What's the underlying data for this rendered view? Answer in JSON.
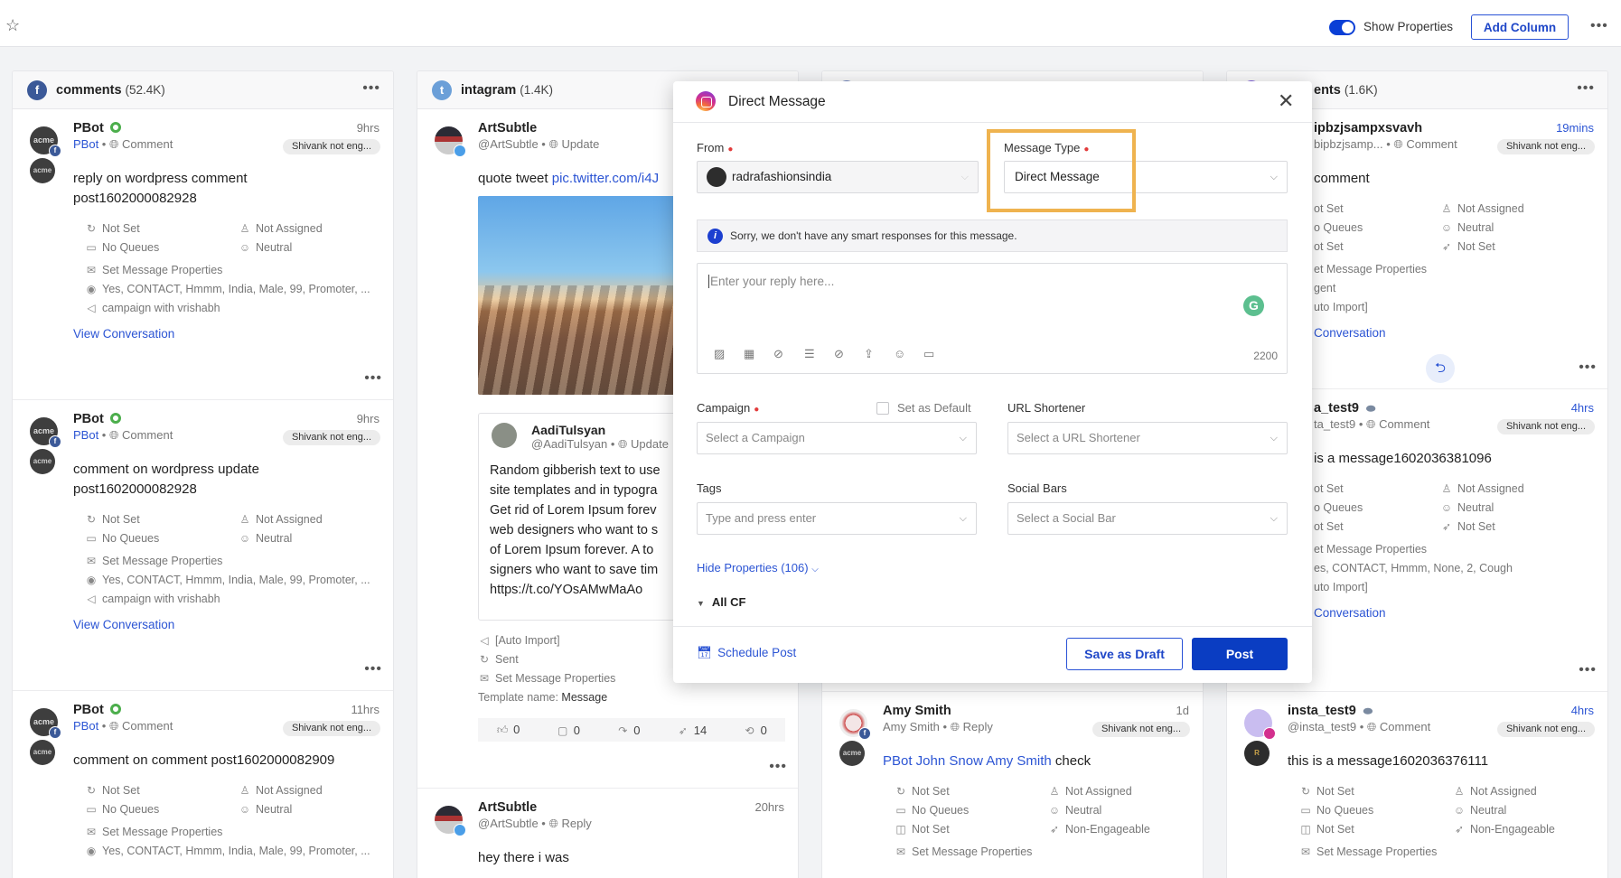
{
  "topbar": {
    "star_icon": "star-icon",
    "show_properties_label": "Show Properties",
    "show_properties_on": true,
    "add_column_label": "Add Column"
  },
  "colors": {
    "accent": "#0a3dc2",
    "link": "#2c55d4",
    "highlight": "#efb34f",
    "online": "#4cae4c",
    "grammarly": "#5cbf8f"
  },
  "columns": [
    {
      "title": "comments",
      "count": "(52.4K)",
      "icon": "facebook-icon",
      "icon_color": "#3b5998",
      "icon_glyph": "f",
      "cards": [
        {
          "avatar": "acme",
          "badge": "facebook",
          "name": "PBot",
          "status": "online",
          "handle": "PBot",
          "handle_link": true,
          "type": "Comment",
          "time": "9hrs",
          "tag": "Shivank not eng...",
          "author": "acme",
          "text": [
            "reply on wordpress comment",
            "post1602000082928"
          ],
          "props": [
            [
              "Not Set",
              "Not Assigned"
            ],
            [
              "No Queues",
              "Neutral"
            ]
          ],
          "lines": [
            {
              "icon": "message-properties-icon",
              "text": "Set Message Properties"
            },
            {
              "icon": "contact-icon",
              "text": "Yes, CONTACT, Hmmm, India, Male, 99, Promoter, ..."
            },
            {
              "icon": "campaign-icon",
              "text": "campaign with vrishabh"
            }
          ],
          "link": "View Conversation",
          "more": true
        },
        {
          "avatar": "acme",
          "badge": "facebook",
          "name": "PBot",
          "status": "online",
          "handle": "PBot",
          "handle_link": true,
          "type": "Comment",
          "time": "9hrs",
          "tag": "Shivank not eng...",
          "author": "acme",
          "text": [
            "comment on wordpress update",
            "post1602000082928"
          ],
          "props": [
            [
              "Not Set",
              "Not Assigned"
            ],
            [
              "No Queues",
              "Neutral"
            ]
          ],
          "lines": [
            {
              "icon": "message-properties-icon",
              "text": "Set Message Properties"
            },
            {
              "icon": "contact-icon",
              "text": "Yes, CONTACT, Hmmm, India, Male, 99, Promoter, ..."
            },
            {
              "icon": "campaign-icon",
              "text": "campaign with vrishabh"
            }
          ],
          "link": "View Conversation",
          "more": true
        },
        {
          "avatar": "acme",
          "badge": "facebook",
          "name": "PBot",
          "status": "online",
          "handle": "PBot",
          "handle_link": true,
          "type": "Comment",
          "time": "11hrs",
          "tag": "Shivank not eng...",
          "author": "acme",
          "text": [
            "comment on comment post1602000082909"
          ],
          "props": [
            [
              "Not Set",
              "Not Assigned"
            ],
            [
              "No Queues",
              "Neutral"
            ]
          ],
          "lines": [
            {
              "icon": "message-properties-icon",
              "text": "Set Message Properties"
            },
            {
              "icon": "contact-icon",
              "text": "Yes, CONTACT, Hmmm, India, Male, 99, Promoter, ..."
            }
          ]
        }
      ]
    },
    {
      "title": "intagram",
      "count": "(1.4K)",
      "icon": "twitter-icon",
      "icon_color": "#6b9fd8",
      "icon_glyph": "t",
      "cards": [
        {
          "avatar": "photo",
          "badge": "twitter",
          "name": "ArtSubtle",
          "handle": "@ArtSubtle",
          "type": "Update",
          "text_segments": [
            {
              "t": "quote tweet "
            },
            {
              "t": "pic.twitter.com/i4J",
              "link": true
            }
          ],
          "image": "landscape-photo",
          "quote": {
            "name": "AadiTulsyan",
            "handle": "@AadiTulsyan",
            "type": "Update",
            "lines": [
              "Random gibberish text to use",
              "site templates and in typogra",
              "Get rid of Lorem Ipsum forev",
              "web designers who want to s",
              "of Lorem Ipsum forever. A to",
              "signers who want to save tim",
              "https://t.co/YOsAMwMaAo"
            ]
          },
          "lines": [
            {
              "icon": "campaign-icon",
              "text": "[Auto Import]"
            },
            {
              "icon": "status-icon",
              "text": "Sent"
            },
            {
              "icon": "message-properties-icon",
              "text": "Set Message Properties"
            },
            {
              "icon": "",
              "text": "Template name: ",
              "value": "Message"
            }
          ],
          "stats": [
            {
              "icon": "like-icon",
              "value": "0"
            },
            {
              "icon": "comment-icon",
              "value": "0"
            },
            {
              "icon": "share-icon",
              "value": "0"
            },
            {
              "icon": "engagement-icon",
              "value": "14"
            },
            {
              "icon": "retweet-icon",
              "value": "0"
            }
          ],
          "more": true
        },
        {
          "avatar": "photo",
          "badge": "twitter",
          "name": "ArtSubtle",
          "handle": "@ArtSubtle",
          "type": "Reply",
          "time": "20hrs",
          "text": [
            "hey there i was"
          ]
        }
      ]
    },
    {
      "title": "",
      "count": "",
      "icon": "channel-icon",
      "icon_color": "#6b7fb8",
      "icon_glyph": "",
      "cards": [
        {
          "hidden": true
        },
        {
          "avatar": "photo-amy",
          "badge": "facebook",
          "name": "Amy Smith",
          "handle": "Amy Smith",
          "type": "Reply",
          "time": "1d",
          "tag": "Shivank not eng...",
          "author": "acme",
          "text_segments": [
            {
              "t": "PBot John Snow Amy Smith",
              "link": true
            },
            {
              "t": " check"
            }
          ],
          "props": [
            [
              "Not Set",
              "Not Assigned"
            ],
            [
              "No Queues",
              "Neutral"
            ],
            [
              "Not Set",
              "Non-Engageable"
            ]
          ],
          "lines": [
            {
              "icon": "message-properties-icon",
              "text": "Set Message Properties"
            }
          ]
        }
      ]
    },
    {
      "title": "ents",
      "count": "(1.6K)",
      "icon": "instagram-icon",
      "icon_color": "#7b5cd6",
      "icon_glyph": "",
      "cards": [
        {
          "clipped": true,
          "name": "ipbzjsampxsvavh",
          "handle": "bipbzjsamp...",
          "type": "Comment",
          "time": "19mins",
          "time_accent": true,
          "tag": "Shivank not eng...",
          "text": [
            "comment"
          ],
          "props": [
            [
              "ot Set",
              "Not Assigned"
            ],
            [
              "o Queues",
              "Neutral"
            ],
            [
              "ot Set",
              "Not Set"
            ]
          ],
          "lines": [
            {
              "icon": "",
              "text": "et Message Properties"
            },
            {
              "icon": "",
              "text": "gent"
            },
            {
              "icon": "",
              "text": "uto Import]"
            }
          ],
          "link": "Conversation",
          "reply_button": true,
          "more": true
        },
        {
          "clipped": true,
          "name": "a_test9",
          "verified": true,
          "handle": "ta_test9",
          "type": "Comment",
          "time": "4hrs",
          "time_accent": true,
          "tag": "Shivank not eng...",
          "text": [
            "is a message1602036381096"
          ],
          "props": [
            [
              "ot Set",
              "Not Assigned"
            ],
            [
              "o Queues",
              "Neutral"
            ],
            [
              "ot Set",
              "Not Set"
            ]
          ],
          "lines": [
            {
              "icon": "",
              "text": "et Message Properties"
            },
            {
              "icon": "",
              "text": "es, CONTACT, Hmmm, None, 2, Cough"
            },
            {
              "icon": "",
              "text": "uto Import]"
            }
          ],
          "link": "Conversation",
          "more": true
        },
        {
          "avatar": "purple",
          "badge": "instagram",
          "name": "insta_test9",
          "verified": true,
          "handle": "@insta_test9",
          "type": "Comment",
          "time": "4hrs",
          "time_accent": true,
          "tag": "Shivank not eng...",
          "author": "radra",
          "text": [
            "this is a message1602036376111"
          ],
          "props": [
            [
              "Not Set",
              "Not Assigned"
            ],
            [
              "No Queues",
              "Neutral"
            ],
            [
              "Not Set",
              "Non-Engageable"
            ]
          ],
          "lines": [
            {
              "icon": "message-properties-icon",
              "text": "Set Message Properties"
            }
          ]
        }
      ]
    }
  ],
  "modal": {
    "title": "Direct Message",
    "from_label": "From",
    "from_value": "radrafashionsindia",
    "message_type_label": "Message Type",
    "message_type_value": "Direct Message",
    "info_text": "Sorry, we don't have any smart responses for this message.",
    "reply_placeholder": "Enter your reply here...",
    "char_count": "2200",
    "toolbar_icons": [
      "image-icon",
      "media-library-icon",
      "link-icon",
      "template-icon",
      "attachment-icon",
      "upload-icon",
      "emoji-icon",
      "gif-icon"
    ],
    "campaign_label": "Campaign",
    "campaign_placeholder": "Select a Campaign",
    "set_default_label": "Set as Default",
    "set_default_checked": false,
    "url_label": "URL Shortener",
    "url_placeholder": "Select a URL Shortener",
    "tags_label": "Tags",
    "tags_placeholder": "Type and press enter",
    "social_label": "Social Bars",
    "social_placeholder": "Select a Social Bar",
    "hide_properties": "Hide Properties (106)",
    "all_cf": "All CF",
    "schedule_post": "Schedule Post",
    "save_draft": "Save as Draft",
    "post": "Post"
  }
}
